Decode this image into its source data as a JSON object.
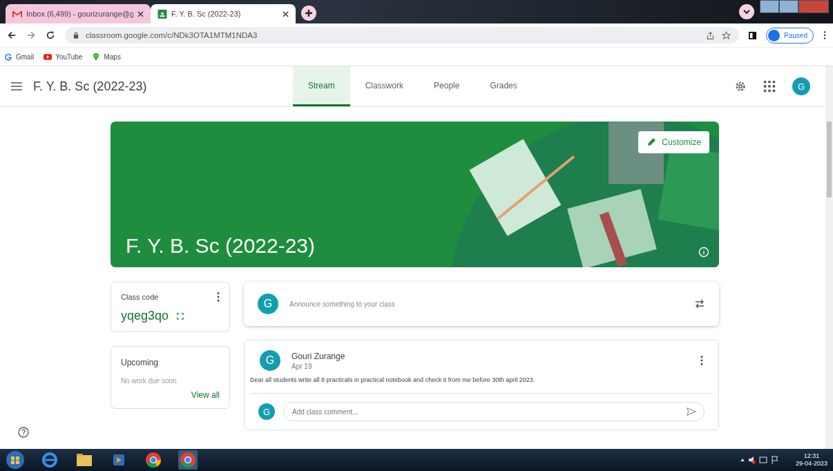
{
  "browser_tabs": [
    {
      "title": "Inbox (6,499) - gourizurange@g",
      "kind": "gmail",
      "selected": false
    },
    {
      "title": "F. Y. B. Sc (2022-23)",
      "kind": "classroom",
      "selected": true
    }
  ],
  "address": {
    "url": "classroom.google.com/c/NDk3OTA1MTM1NDA3"
  },
  "profile": {
    "label": "Paused"
  },
  "bookmarks": [
    {
      "label": "Gmail",
      "kind": "gmail"
    },
    {
      "label": "YouTube",
      "kind": "youtube"
    },
    {
      "label": "Maps",
      "kind": "maps"
    }
  ],
  "header": {
    "title": "F. Y. B. Sc (2022-23)",
    "avatar": "G"
  },
  "nav_tabs": [
    {
      "label": "Stream",
      "selected": true
    },
    {
      "label": "Classwork",
      "selected": false
    },
    {
      "label": "People",
      "selected": false
    },
    {
      "label": "Grades",
      "selected": false
    }
  ],
  "banner": {
    "title": "F. Y. B. Sc (2022-23)",
    "button": "Customize"
  },
  "class_code": {
    "label": "Class code",
    "code": "yqeg3qo"
  },
  "upcoming": {
    "title": "Upcoming",
    "note": "No work due soon",
    "link": "View all"
  },
  "announce": {
    "avatar": "G",
    "placeholder": "Announce something to your class"
  },
  "posts": [
    {
      "avatar": "G",
      "author": "Gouri Zurange",
      "date": "Apr 19",
      "body": "Dear all students write all 8 practicals in practical notebook and check it from me before 30th april 2023.",
      "comment_avatar": "G",
      "comment_placeholder": "Add class comment..."
    }
  ],
  "taskbar": {
    "time": "12:31",
    "date": "29-04-2023"
  }
}
